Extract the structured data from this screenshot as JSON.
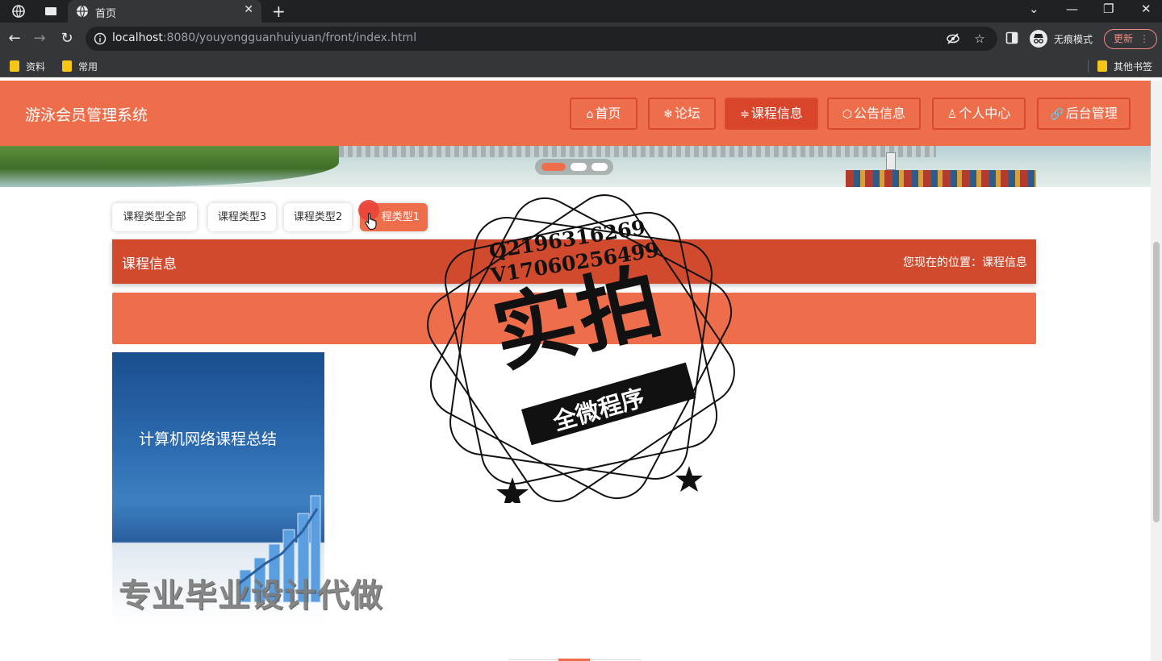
{
  "browser": {
    "tab_title": "首页",
    "new_tab": "+",
    "close_tab": "✕",
    "url_host": "localhost",
    "url_rest": ":8080/youyongguanhuiyuan/front/index.html",
    "incognito_label": "无痕模式",
    "update_label": "更新",
    "update_menu": "⋮",
    "bookmarks": [
      "资料",
      "常用"
    ],
    "other_bookmarks": "其他书签",
    "window_controls": [
      "⌄",
      "—",
      "❐",
      "✕"
    ]
  },
  "site": {
    "title": "游泳会员管理系统",
    "nav": [
      {
        "icon": "⌂",
        "label": "首页"
      },
      {
        "icon": "❄",
        "label": "论坛"
      },
      {
        "icon": "≑",
        "label": "课程信息"
      },
      {
        "icon": "⬡",
        "label": "公告信息"
      },
      {
        "icon": "♙",
        "label": "个人中心"
      },
      {
        "icon": "🔗",
        "label": "后台管理"
      }
    ],
    "active_nav": "课程信息"
  },
  "filters": [
    "课程类型全部",
    "课程类型3",
    "课程类型2",
    "课程类型1"
  ],
  "active_filter": "课程类型1",
  "active_filter_visible_text": "程类型1",
  "section": {
    "title": "课程信息",
    "location": "您现在的位置：课程信息"
  },
  "course_card": {
    "cover_text": "计算机网络课程总结"
  },
  "watermark": {
    "qq": "Q2196316269",
    "wechat": "V17060256499",
    "big": "实拍",
    "ribbon": "全微程序",
    "bottom": "专业毕业设计代做"
  },
  "colors": {
    "primary": "#ee6e4c",
    "primary_dark": "#d24a2d",
    "chrome_dark": "#202124",
    "chrome": "#35363a"
  }
}
